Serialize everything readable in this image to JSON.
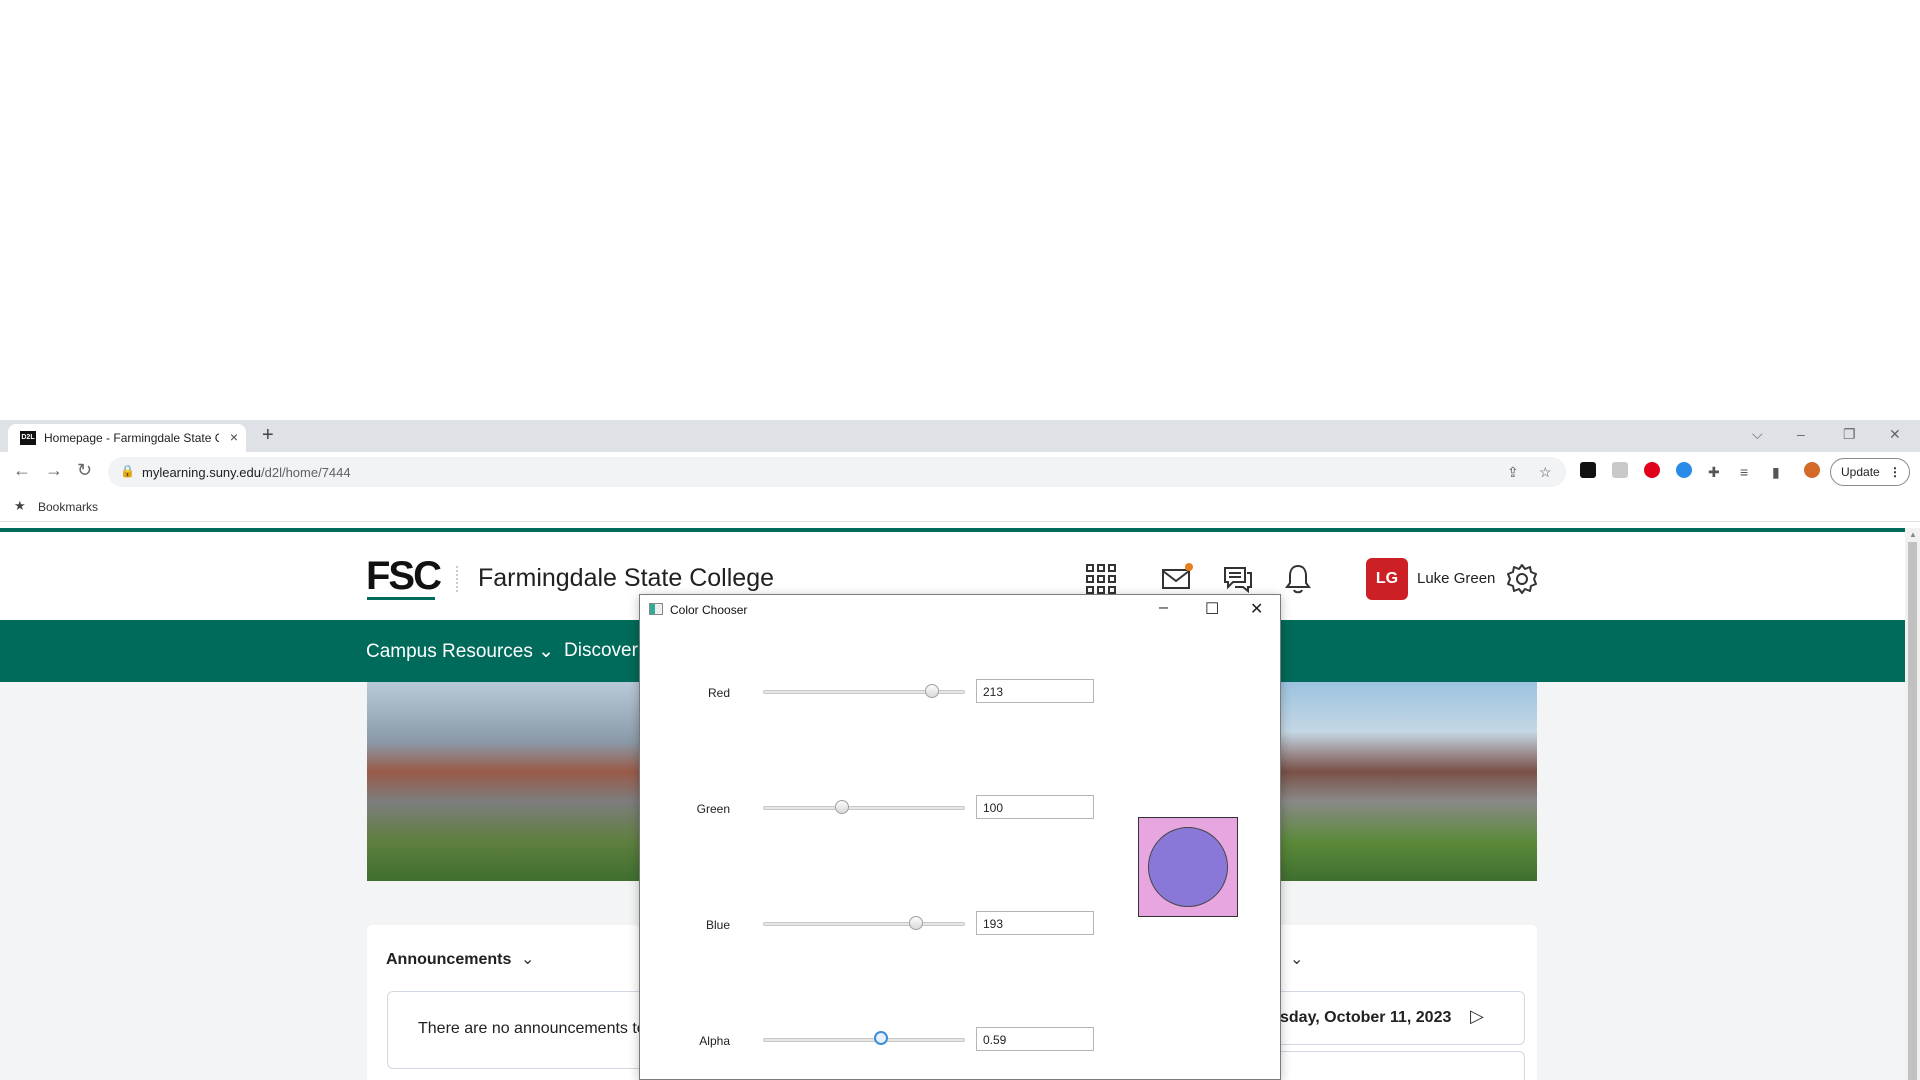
{
  "browser": {
    "tab_title": "Homepage - Farmingdale State C",
    "tab_favicon": "D2L",
    "tab_close": "×",
    "new_tab": "+",
    "url_host": "mylearning.suny.edu",
    "url_path": "/d2l/home/7444",
    "update_label": "Update",
    "bookmarks_label": "Bookmarks"
  },
  "page": {
    "logo": "FSC",
    "college_name": "Farmingdale State College",
    "avatar_initials": "LG",
    "user_name": "Luke Green",
    "nav_items": [
      "Campus Resources",
      "Discover"
    ],
    "announcements_title": "Announcements",
    "announcements_empty": "There are no announcements to",
    "calendar_date": "sday, October 11, 2023",
    "brand_color": "#006b5a"
  },
  "dialog": {
    "title": "Color Chooser",
    "rows": [
      {
        "label": "Red",
        "value": "213",
        "fraction": 0.835
      },
      {
        "label": "Green",
        "value": "100",
        "fraction": 0.392
      },
      {
        "label": "Blue",
        "value": "193",
        "fraction": 0.757
      },
      {
        "label": "Alpha",
        "value": "0.59",
        "fraction": 0.59
      }
    ],
    "preview_background": "#e8a6e0",
    "preview_circle": "#8a78d8"
  }
}
